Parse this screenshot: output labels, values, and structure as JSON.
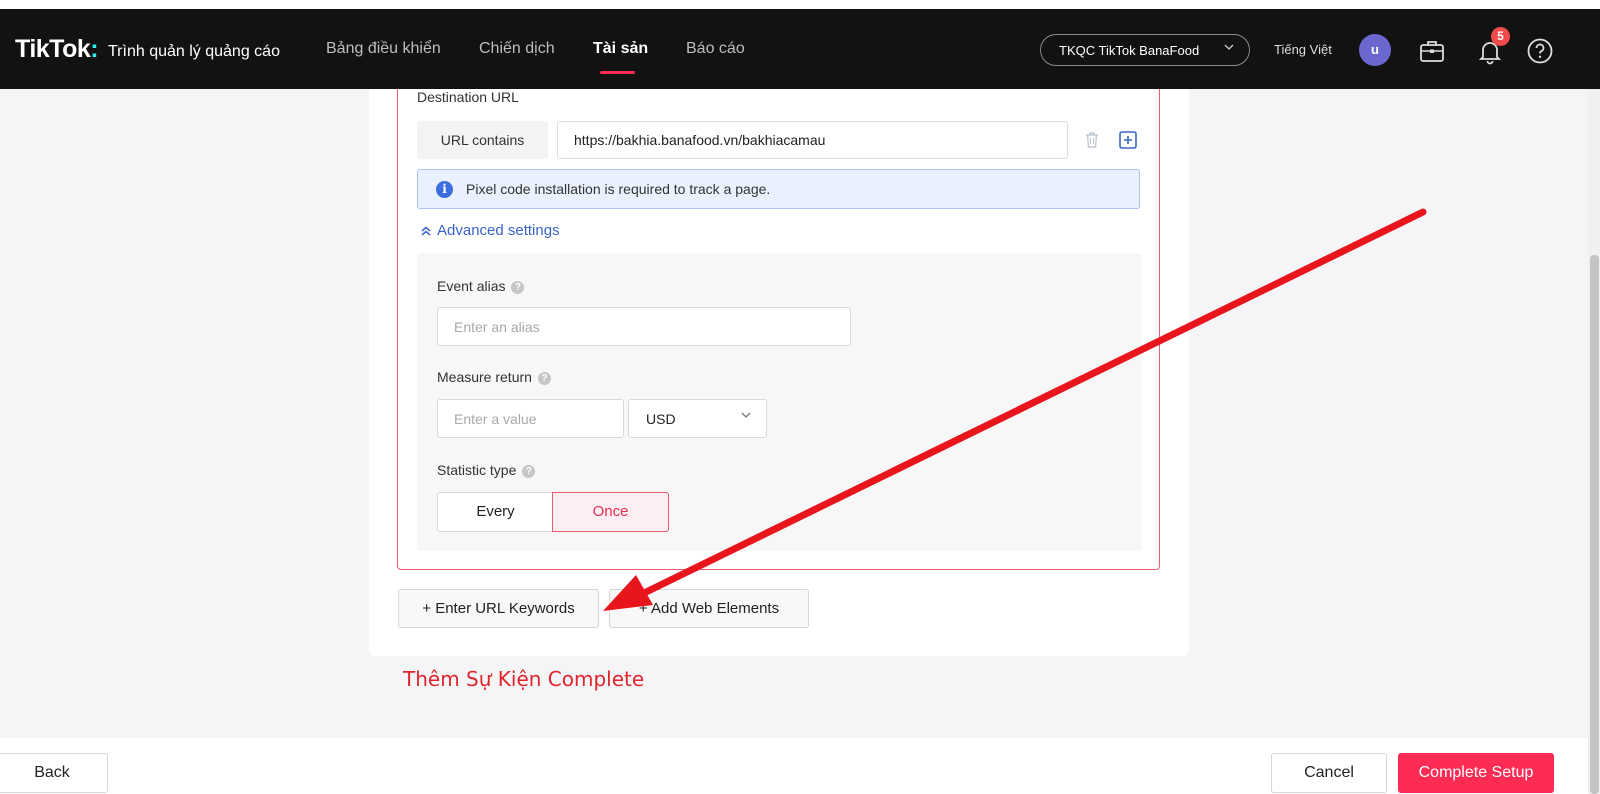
{
  "header": {
    "logo": "TikTok",
    "logo_colon": ":",
    "subtitle": "Trình quản lý quảng cáo",
    "nav": [
      {
        "label": "Bảng điều khiển"
      },
      {
        "label": "Chiến dịch"
      },
      {
        "label": "Tài sản"
      },
      {
        "label": "Báo cáo"
      }
    ],
    "active_nav": "Tài sản",
    "account": "TKQC TikTok BanaFood",
    "language": "Tiếng Việt",
    "avatar_letter": "u",
    "notification_count": "5",
    "icons": [
      "briefcase-icon",
      "bell-icon",
      "help-icon",
      "chevron-down-icon"
    ]
  },
  "rule": {
    "destination_label": "Destination URL",
    "url_match_type": "URL contains",
    "url_value": "https://bakhia.banafood.vn/bakhiacamau",
    "info_text": "Pixel code installation is required to track a page.",
    "advanced_settings": "Advanced settings",
    "event_alias_label": "Event alias",
    "event_alias_placeholder": "Enter an alias",
    "measure_return_label": "Measure return",
    "measure_return_placeholder": "Enter a value",
    "currency": "USD",
    "statistic_type_label": "Statistic type",
    "statistic_options": [
      "Every",
      "Once"
    ],
    "statistic_selected": "Once"
  },
  "actions": {
    "enter_url_keywords": "+ Enter URL Keywords",
    "add_web_elements": "+ Add Web Elements"
  },
  "annotation": {
    "note": "Thêm Sự Kiện Complete",
    "arrow_color": "#e8161c"
  },
  "footer": {
    "back": "Back",
    "cancel": "Cancel",
    "complete": "Complete Setup"
  },
  "colors": {
    "accent": "#fe2c55",
    "link": "#3a63c8",
    "header_bg": "#121212"
  }
}
